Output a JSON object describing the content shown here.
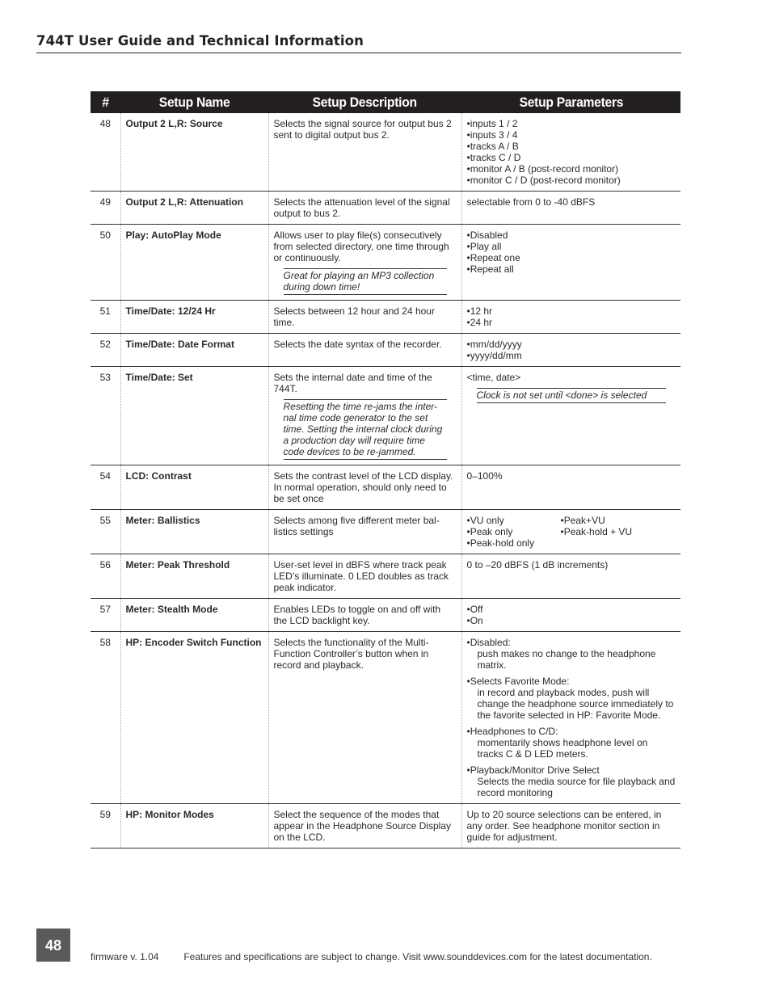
{
  "header": {
    "title": "744T User Guide and Technical Information"
  },
  "table": {
    "columns": [
      "#",
      "Setup Name",
      "Setup Description",
      "Setup Parameters"
    ],
    "rows": [
      {
        "num": "48",
        "name": "Output 2 L,R: Source",
        "desc": "Selects the signal source for output bus 2 sent to digital output bus 2.",
        "params": [
          "inputs 1 / 2",
          "inputs 3 / 4",
          "tracks A / B",
          "tracks C / D",
          "monitor A / B (post-record monitor)",
          "monitor C / D (post-record monitor)"
        ]
      },
      {
        "num": "49",
        "name": "Output 2 L,R: Attenuation",
        "desc": "Selects the attenuation level of the signal output to bus 2.",
        "param_text": "selectable from 0 to -40 dBFS"
      },
      {
        "num": "50",
        "name": "Play: AutoPlay Mode",
        "desc": "Allows user to play file(s) consecutively from selected directory, one time through or continuously.",
        "desc_note": "Great for playing an MP3 collection during down time!",
        "params": [
          "Disabled",
          "Play all",
          "Repeat one",
          "Repeat all"
        ]
      },
      {
        "num": "51",
        "name": "Time/Date: 12/24 Hr",
        "desc": "Selects between 12 hour and 24 hour time.",
        "params": [
          "12 hr",
          "24 hr"
        ]
      },
      {
        "num": "52",
        "name": "Time/Date: Date Format",
        "desc": "Selects the date syntax of the recorder.",
        "params": [
          "mm/dd/yyyy",
          "yyyy/dd/mm"
        ]
      },
      {
        "num": "53",
        "name": "Time/Date: Set",
        "desc": "Sets the internal date and time of the 744T.",
        "desc_note": "Resetting the time re-jams the inter-nal time code generator to the set time. Setting the internal clock during a production day will require time code devices to be re-jammed.",
        "param_text": "<time, date>",
        "param_note": "Clock is not set until <done> is selected"
      },
      {
        "num": "54",
        "name": "LCD: Contrast",
        "desc": "Sets the contrast level of the LCD display. In normal operation, should only need to be set once",
        "param_text": "0–100%"
      },
      {
        "num": "55",
        "name": "Meter: Ballistics",
        "desc": "Selects among five different meter bal-listics settings",
        "params_grid": [
          "VU only",
          "Peak+VU",
          "Peak only",
          "Peak-hold + VU",
          "Peak-hold only"
        ]
      },
      {
        "num": "56",
        "name": "Meter: Peak Threshold",
        "desc": "User-set level in dBFS where track peak LED’s illuminate. 0 LED doubles as track peak indicator.",
        "param_text": "0 to –20 dBFS (1 dB increments)"
      },
      {
        "num": "57",
        "name": "Meter: Stealth Mode",
        "desc": "Enables LEDs to toggle on and off with the LCD backlight key.",
        "params": [
          "Off",
          "On"
        ]
      },
      {
        "num": "58",
        "name": "HP: Encoder Switch Function",
        "desc": "Selects the functionality of the Multi-Function Controller’s button when in record and playback.",
        "param_blocks": [
          {
            "head": "Disabled:",
            "body": "push makes no change to the headphone matrix."
          },
          {
            "head": "Selects Favorite Mode:",
            "body": "in record and playback modes, push will change the headphone source immediately to the favorite selected in HP: Favorite Mode."
          },
          {
            "head": "Headphones to C/D:",
            "body": "momentarily shows headphone level on tracks C & D LED meters."
          },
          {
            "head": "Playback/Monitor Drive Select",
            "body": "Selects the media source for file playback and record monitoring"
          }
        ]
      },
      {
        "num": "59",
        "name": "HP: Monitor Modes",
        "desc": "Select the sequence of the modes that appear in the Headphone Source Display on the LCD.",
        "param_text": "Up to 20 source selections can be entered, in any order. See headphone monitor section in guide for adjustment."
      }
    ]
  },
  "footer": {
    "page_number": "48",
    "firmware": "firmware v. 1.04",
    "notice": "Features and specifications are subject to change. Visit www.sounddevices.com for the latest documentation."
  }
}
